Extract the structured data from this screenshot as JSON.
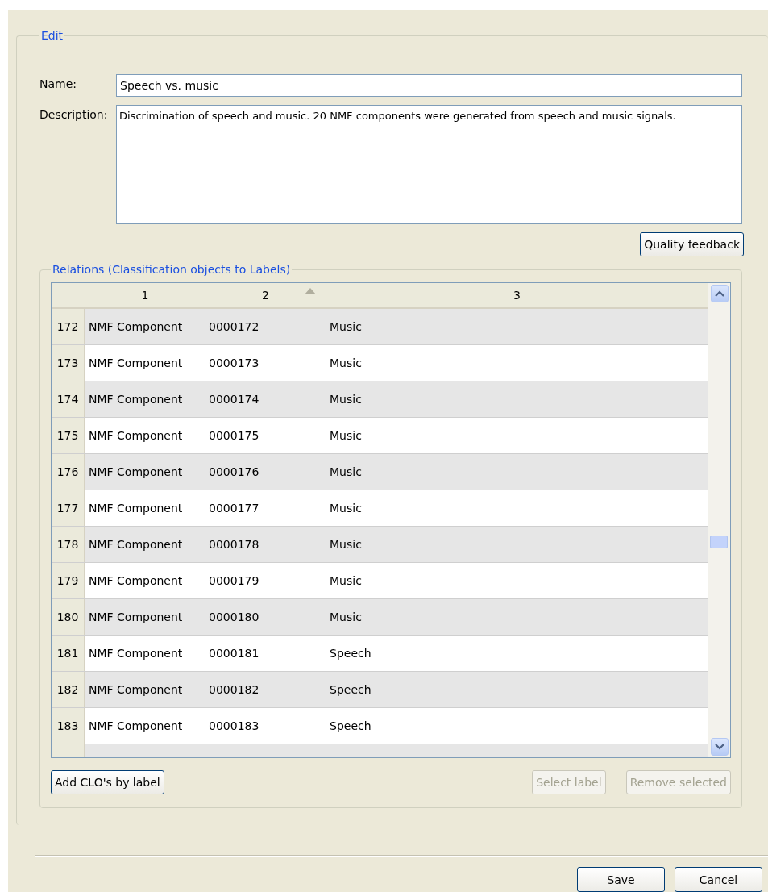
{
  "edit_group": {
    "title": "Edit"
  },
  "name": {
    "label": "Name:",
    "value": "Speech vs. music"
  },
  "description": {
    "label": "Description:",
    "value": "Discrimination of speech and music. 20 NMF components were generated from speech and music signals."
  },
  "quality_button": {
    "label": "Quality feedback",
    "disabled": false
  },
  "relations": {
    "title": "Relations (Classification objects to Labels)",
    "columns": [
      {
        "label": "1",
        "sorted": false
      },
      {
        "label": "2",
        "sorted": true
      },
      {
        "label": "3",
        "sorted": false
      }
    ],
    "rows": [
      {
        "number": "172",
        "cells": [
          "NMF Component",
          "0000172",
          "Music"
        ]
      },
      {
        "number": "173",
        "cells": [
          "NMF Component",
          "0000173",
          "Music"
        ]
      },
      {
        "number": "174",
        "cells": [
          "NMF Component",
          "0000174",
          "Music"
        ]
      },
      {
        "number": "175",
        "cells": [
          "NMF Component",
          "0000175",
          "Music"
        ]
      },
      {
        "number": "176",
        "cells": [
          "NMF Component",
          "0000176",
          "Music"
        ]
      },
      {
        "number": "177",
        "cells": [
          "NMF Component",
          "0000177",
          "Music"
        ]
      },
      {
        "number": "178",
        "cells": [
          "NMF Component",
          "0000178",
          "Music"
        ]
      },
      {
        "number": "179",
        "cells": [
          "NMF Component",
          "0000179",
          "Music"
        ]
      },
      {
        "number": "180",
        "cells": [
          "NMF Component",
          "0000180",
          "Music"
        ]
      },
      {
        "number": "181",
        "cells": [
          "NMF Component",
          "0000181",
          "Speech"
        ]
      },
      {
        "number": "182",
        "cells": [
          "NMF Component",
          "0000182",
          "Speech"
        ]
      },
      {
        "number": "183",
        "cells": [
          "NMF Component",
          "0000183",
          "Speech"
        ]
      }
    ],
    "buttons": [
      {
        "label": "Add CLO's by label",
        "disabled": false
      },
      {
        "label": "Select label",
        "disabled": true
      },
      {
        "label": "Remove selected",
        "disabled": true
      }
    ]
  },
  "footer_buttons": [
    {
      "label": "Save",
      "disabled": false
    },
    {
      "label": "Cancel",
      "disabled": false
    }
  ]
}
